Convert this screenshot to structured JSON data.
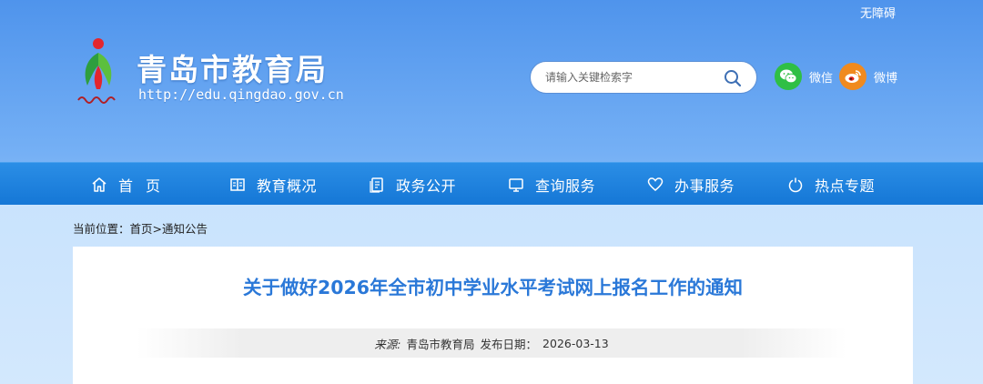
{
  "header": {
    "accessibility_link": "无障碍",
    "site_name": "青岛市教育局",
    "site_url": "http://edu.qingdao.gov.cn",
    "search": {
      "placeholder": "请输入关键检索字"
    },
    "social": [
      {
        "label": "微信",
        "icon": "wechat-icon",
        "color": "#2fbf45"
      },
      {
        "label": "微博",
        "icon": "weibo-icon",
        "color": "#f08a1f"
      }
    ]
  },
  "nav": [
    {
      "label": "首页",
      "icon": "home-icon"
    },
    {
      "label": "教育概况",
      "icon": "book-icon"
    },
    {
      "label": "政务公开",
      "icon": "document-icon"
    },
    {
      "label": "查询服务",
      "icon": "monitor-icon"
    },
    {
      "label": "办事服务",
      "icon": "heart-icon"
    },
    {
      "label": "热点专题",
      "icon": "power-icon"
    }
  ],
  "breadcrumb": {
    "prefix": "当前位置：",
    "items": [
      "首页",
      "通知公告"
    ],
    "separator": ">"
  },
  "article": {
    "title": "关于做好2026年全市初中学业水平考试网上报名工作的通知",
    "source_label": "来源:",
    "source": "青岛市教育局",
    "date_label": "发布日期：",
    "date": "2026-03-13"
  },
  "colors": {
    "nav_bg": "#1577d6",
    "title": "#2a78d8",
    "header_top": "#4f94ec"
  }
}
